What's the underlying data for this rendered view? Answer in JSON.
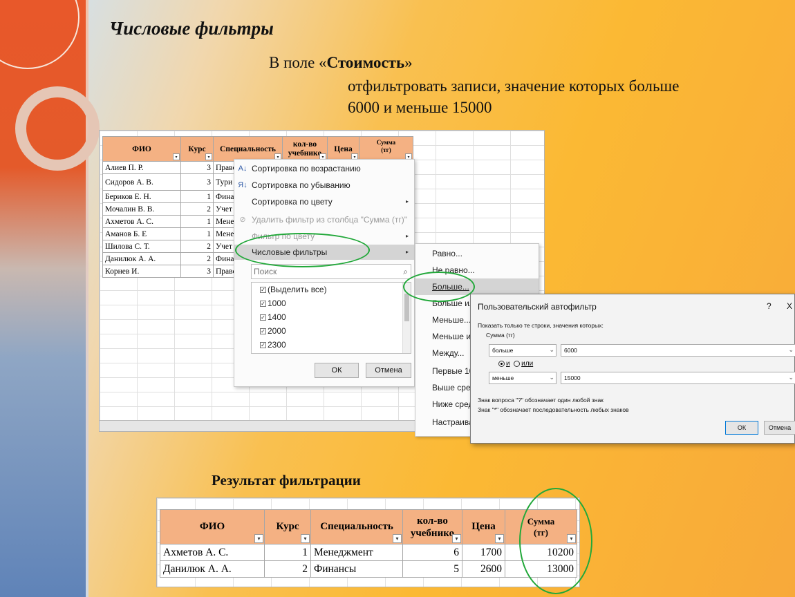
{
  "slide": {
    "title": "Числовые фильтры",
    "task_prefix": "В поле «",
    "task_field": "Стоимость",
    "task_suffix": "»",
    "task_line2": "отфильтровать записи, значение которых больше",
    "task_line3": "6000 и меньше 15000",
    "result_title": "Результат  фильтрации"
  },
  "source_table": {
    "headers": [
      "ФИО",
      "Курс",
      "Специальность",
      "кол-во учебнико",
      "Цена",
      "Сумма (тг)"
    ],
    "rows": [
      [
        "Алиев П. Р.",
        "3",
        "Право"
      ],
      [
        "Сидоров А. В.",
        "3",
        "Тури"
      ],
      [
        "Бериков Е. Н.",
        "1",
        "Фина"
      ],
      [
        "Мочалин В. В.",
        "2",
        "Учет"
      ],
      [
        "Ахметов А. С.",
        "1",
        "Мене"
      ],
      [
        "Аманов Б. Е",
        "1",
        "Мене"
      ],
      [
        "Шилова С. Т.",
        "2",
        "Учет"
      ],
      [
        "Данилюк А. А.",
        "2",
        "Фина"
      ],
      [
        "Корнев И.",
        "3",
        "Право"
      ]
    ]
  },
  "filter_menu": {
    "items": [
      {
        "label": "Сортировка по возрастанию",
        "icon": "sort-asc-icon"
      },
      {
        "label": "Сортировка по убыванию",
        "icon": "sort-desc-icon"
      },
      {
        "label": "Сортировка по цвету"
      },
      {
        "label": "Удалить фильтр из столбца \"Сумма  (тг)\"",
        "icon": "clear-filter-icon"
      },
      {
        "label": "Фильтр по цвету"
      },
      {
        "label": "Числовые фильтры"
      }
    ],
    "search_placeholder": "Поиск",
    "checkbox_items": [
      "(Выделить все)",
      "1000",
      "1400",
      "2000",
      "2300"
    ],
    "ok_label": "ОК",
    "cancel_label": "Отмена"
  },
  "submenu": {
    "items": [
      "Равно...",
      "Не равно...",
      "Больше...",
      "Больше или равно...",
      "Меньше...",
      "Меньше или равно...",
      "Между...",
      "Первые 10...",
      "Выше среднего",
      "Ниже среднего",
      "Настраиваемый фильтр..."
    ]
  },
  "dialog": {
    "title": "Пользовательский автофильтр",
    "help": "?",
    "close": "X",
    "caption": "Показать только те строки, значения которых:",
    "field_name": "Сумма  (тг)",
    "cond1_op": "больше",
    "cond1_val": "6000",
    "and_label": "и",
    "or_label": "или",
    "cond2_op": "меньше",
    "cond2_val": "15000",
    "hint1": "Знак вопроса \"?\" обозначает один любой знак",
    "hint2": "Знак \"*\" обозначает последовательность любых знаков",
    "ok_label": "ОК",
    "cancel_label": "Отмена"
  },
  "result_table": {
    "headers": [
      "ФИО",
      "Курс",
      "Специальность",
      "кол-во учебнико",
      "Цена",
      "Сумма (тг)"
    ],
    "rows": [
      [
        "Ахметов А. С.",
        "1",
        "Менеджмент",
        "6",
        "1700",
        "10200"
      ],
      [
        "Данилюк А. А.",
        "2",
        "Финансы",
        "5",
        "2600",
        "13000"
      ]
    ]
  },
  "colors": {
    "header_fill": "#f4b183",
    "highlight_ellipse": "#22a83a",
    "background": "#fbb934"
  }
}
